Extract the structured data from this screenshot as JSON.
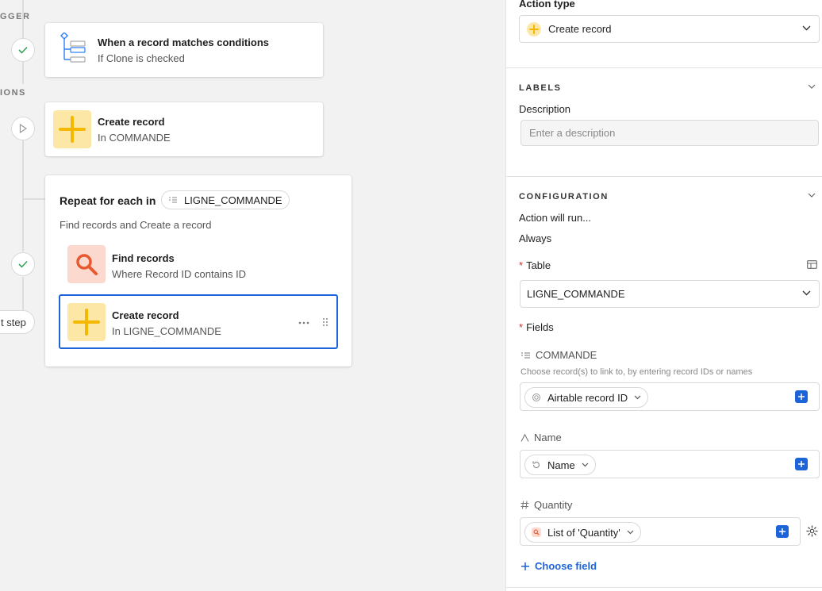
{
  "canvas": {
    "trigger_section": "GGER",
    "actions_section": "IONS",
    "trigger_card": {
      "title": "When a record matches conditions",
      "subtitle": "If Clone is checked"
    },
    "create_card": {
      "title": "Create record",
      "subtitle": "In COMMANDE"
    },
    "repeat_block": {
      "title": "Repeat for each in",
      "list_pill": "LIGNE_COMMANDE",
      "summary": "Find records and Create a record",
      "find_card": {
        "title": "Find records",
        "subtitle": "Where Record ID contains ID"
      },
      "create_card": {
        "title": "Create record",
        "subtitle": "In LIGNE_COMMANDE"
      }
    },
    "next_step_button": "t step",
    "icons": {
      "trigger": "tree-icon",
      "create": "plus-icon",
      "find": "search-icon",
      "check": "check-icon",
      "run": "play-icon",
      "more": "ellipsis-icon",
      "drag": "drag-handle-icon"
    }
  },
  "panel": {
    "action_type": {
      "label": "Action type",
      "value": "Create record"
    },
    "labels_section": {
      "heading": "LABELS",
      "description_label": "Description",
      "description_placeholder": "Enter a description"
    },
    "configuration_section": {
      "heading": "CONFIGURATION",
      "action_runs_label": "Action will run...",
      "action_runs_value": "Always",
      "table_label": "Table",
      "table_required": "*",
      "table_value": "LIGNE_COMMANDE",
      "fields_label": "Fields",
      "fields_required": "*",
      "fields": [
        {
          "name": "COMMANDE",
          "hint": "Choose record(s) to link to, by entering record IDs or names",
          "token": "Airtable record ID",
          "icon": "linked-record-icon"
        },
        {
          "name": "Name",
          "token": "Name",
          "icon": "text-field-icon"
        },
        {
          "name": "Quantity",
          "token": "List of 'Quantity'",
          "icon": "number-field-icon"
        }
      ],
      "choose_field": "Choose field"
    },
    "colors": {
      "accent_blue": "#1d64d8",
      "required_red": "#d0342c",
      "create_tile": "#fde7a6",
      "find_tile": "#fcd9cf",
      "plus_yellow": "#f5b800",
      "search_orange": "#e8592f"
    }
  }
}
